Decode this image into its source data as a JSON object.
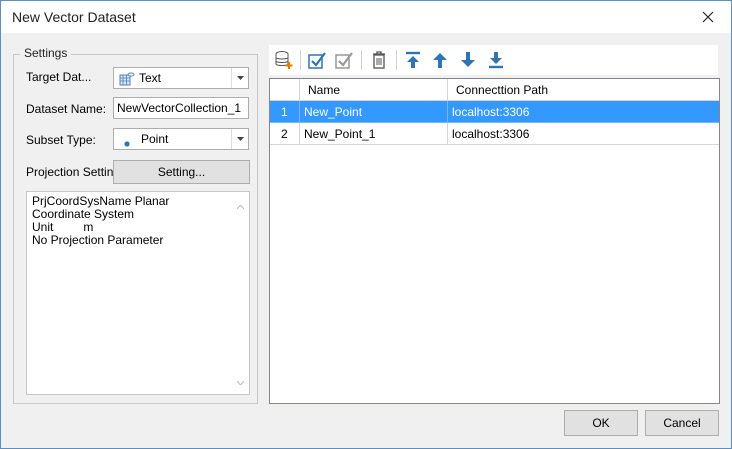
{
  "window": {
    "title": "New Vector Dataset"
  },
  "settings": {
    "legend": "Settings",
    "target_label": "Target Dat...",
    "target_value": "Text",
    "dataset_name_label": "Dataset Name:",
    "dataset_name_value": "NewVectorCollection_1",
    "subset_type_label": "Subset Type:",
    "subset_type_value": "Point",
    "projection_label": "Projection Settin",
    "setting_button": "Setting...",
    "projection_lines": [
      "PrjCoordSysName  Planar Coordinate System",
      "Unit         m",
      "No Projection Parameter"
    ]
  },
  "toolbar": {
    "icons": [
      "add-dataset-icon",
      "select-all-icon",
      "invert-selection-icon",
      "delete-icon",
      "move-top-icon",
      "move-up-icon",
      "move-down-icon",
      "move-bottom-icon"
    ]
  },
  "grid": {
    "headers": [
      "",
      "Name",
      "Connecttion Path"
    ],
    "rows": [
      {
        "index": "1",
        "name": "New_Point",
        "path": "localhost:3306",
        "selected": true
      },
      {
        "index": "2",
        "name": "New_Point_1",
        "path": "localhost:3306",
        "selected": false
      }
    ]
  },
  "footer": {
    "ok": "OK",
    "cancel": "Cancel"
  },
  "colors": {
    "selection": "#3399ff",
    "accent_blue": "#2e75b6",
    "window_border": "#5a8fc4"
  }
}
